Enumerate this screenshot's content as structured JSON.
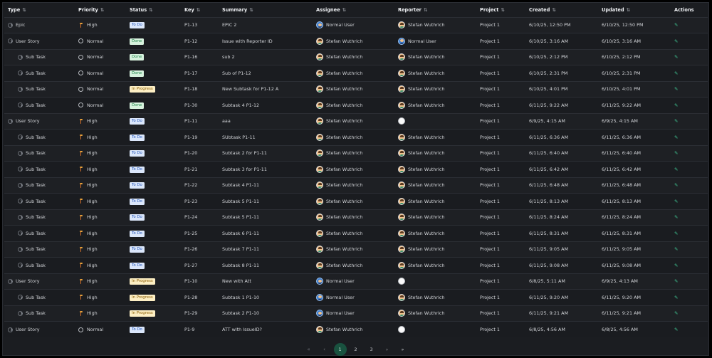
{
  "columns": {
    "type": "Type",
    "priority": "Priority",
    "status": "Status",
    "key": "Key",
    "summary": "Summary",
    "assignee": "Assignee",
    "reporter": "Reporter",
    "project": "Project",
    "created": "Created",
    "updated": "Updated",
    "actions": "Actions"
  },
  "sort_glyph": "⇅",
  "rows": [
    {
      "type": "Epic",
      "child": false,
      "priority": "High",
      "status": "To Do",
      "key": "P1-13",
      "summary": "EPIC 2",
      "assignee": "Normal User",
      "reporter": "Stefan Wuthrich",
      "project": "Project 1",
      "created": "6/10/25, 12:50 PM",
      "updated": "6/10/25, 12:50 PM"
    },
    {
      "type": "User Story",
      "child": false,
      "priority": "Normal",
      "status": "Done",
      "key": "P1-12",
      "summary": "Issue with Reporter ID",
      "assignee": "Stefan Wuthrich",
      "reporter": "Normal User",
      "project": "Project 1",
      "created": "6/10/25, 3:16 AM",
      "updated": "6/10/25, 3:16 AM"
    },
    {
      "type": "Sub Task",
      "child": true,
      "priority": "Normal",
      "status": "Done",
      "key": "P1-16",
      "summary": "sub 2",
      "assignee": "Stefan Wuthrich",
      "reporter": "Stefan Wuthrich",
      "project": "Project 1",
      "created": "6/10/25, 2:12 PM",
      "updated": "6/10/25, 2:12 PM"
    },
    {
      "type": "Sub Task",
      "child": true,
      "priority": "Normal",
      "status": "Done",
      "key": "P1-17",
      "summary": "Sub of P1-12",
      "assignee": "Stefan Wuthrich",
      "reporter": "Stefan Wuthrich",
      "project": "Project 1",
      "created": "6/10/25, 2:31 PM",
      "updated": "6/10/25, 2:31 PM"
    },
    {
      "type": "Sub Task",
      "child": true,
      "priority": "Normal",
      "status": "In Progress",
      "key": "P1-18",
      "summary": "New Subtask for P1-12 A",
      "assignee": "Stefan Wuthrich",
      "reporter": "Stefan Wuthrich",
      "project": "Project 1",
      "created": "6/10/25, 4:01 PM",
      "updated": "6/10/25, 4:01 PM"
    },
    {
      "type": "Sub Task",
      "child": true,
      "priority": "Normal",
      "status": "Done",
      "key": "P1-30",
      "summary": "Subtask 4 P1-12",
      "assignee": "Stefan Wuthrich",
      "reporter": "Stefan Wuthrich",
      "project": "Project 1",
      "created": "6/11/25, 9:22 AM",
      "updated": "6/11/25, 9:22 AM"
    },
    {
      "type": "User Story",
      "child": false,
      "priority": "High",
      "status": "To Do",
      "key": "P1-11",
      "summary": "aaa",
      "assignee": "Stefan Wuthrich",
      "reporter": "",
      "project": "Project 1",
      "created": "6/9/25, 4:15 AM",
      "updated": "6/9/25, 4:15 AM"
    },
    {
      "type": "Sub Task",
      "child": true,
      "priority": "High",
      "status": "To Do",
      "key": "P1-19",
      "summary": "SUbtask P1-11",
      "assignee": "Stefan Wuthrich",
      "reporter": "Stefan Wuthrich",
      "project": "Project 1",
      "created": "6/11/25, 6:36 AM",
      "updated": "6/11/25, 6:36 AM"
    },
    {
      "type": "Sub Task",
      "child": true,
      "priority": "High",
      "status": "To Do",
      "key": "P1-20",
      "summary": "Subtask 2 for P1-11",
      "assignee": "Stefan Wuthrich",
      "reporter": "Stefan Wuthrich",
      "project": "Project 1",
      "created": "6/11/25, 6:40 AM",
      "updated": "6/11/25, 6:40 AM"
    },
    {
      "type": "Sub Task",
      "child": true,
      "priority": "High",
      "status": "To Do",
      "key": "P1-21",
      "summary": "Subtask 3 for P1-11",
      "assignee": "Stefan Wuthrich",
      "reporter": "Stefan Wuthrich",
      "project": "Project 1",
      "created": "6/11/25, 6:42 AM",
      "updated": "6/11/25, 6:42 AM"
    },
    {
      "type": "Sub Task",
      "child": true,
      "priority": "High",
      "status": "To Do",
      "key": "P1-22",
      "summary": "Subtask 4 P1-11",
      "assignee": "Stefan Wuthrich",
      "reporter": "Stefan Wuthrich",
      "project": "Project 1",
      "created": "6/11/25, 6:48 AM",
      "updated": "6/11/25, 6:48 AM"
    },
    {
      "type": "Sub Task",
      "child": true,
      "priority": "High",
      "status": "To Do",
      "key": "P1-23",
      "summary": "Subtask 5 P1-11",
      "assignee": "Stefan Wuthrich",
      "reporter": "Stefan Wuthrich",
      "project": "Project 1",
      "created": "6/11/25, 8:13 AM",
      "updated": "6/11/25, 8:13 AM"
    },
    {
      "type": "Sub Task",
      "child": true,
      "priority": "High",
      "status": "To Do",
      "key": "P1-24",
      "summary": "Subtask 5 P1-11",
      "assignee": "Stefan Wuthrich",
      "reporter": "Stefan Wuthrich",
      "project": "Project 1",
      "created": "6/11/25, 8:24 AM",
      "updated": "6/11/25, 8:24 AM"
    },
    {
      "type": "Sub Task",
      "child": true,
      "priority": "High",
      "status": "To Do",
      "key": "P1-25",
      "summary": "Subtask 6 P1-11",
      "assignee": "Stefan Wuthrich",
      "reporter": "Stefan Wuthrich",
      "project": "Project 1",
      "created": "6/11/25, 8:31 AM",
      "updated": "6/11/25, 8:31 AM"
    },
    {
      "type": "Sub Task",
      "child": true,
      "priority": "High",
      "status": "To Do",
      "key": "P1-26",
      "summary": "Subtask 7 P1-11",
      "assignee": "Stefan Wuthrich",
      "reporter": "Stefan Wuthrich",
      "project": "Project 1",
      "created": "6/11/25, 9:05 AM",
      "updated": "6/11/25, 9:05 AM"
    },
    {
      "type": "Sub Task",
      "child": true,
      "priority": "High",
      "status": "To Do",
      "key": "P1-27",
      "summary": "Subtask 8 P1-11",
      "assignee": "Stefan Wuthrich",
      "reporter": "Stefan Wuthrich",
      "project": "Project 1",
      "created": "6/11/25, 9:08 AM",
      "updated": "6/11/25, 9:08 AM"
    },
    {
      "type": "User Story",
      "child": false,
      "priority": "High",
      "status": "In Progress",
      "key": "P1-10",
      "summary": "New with Att",
      "assignee": "Normal User",
      "reporter": "",
      "project": "Project 1",
      "created": "6/8/25, 5:11 AM",
      "updated": "6/9/25, 4:13 AM"
    },
    {
      "type": "Sub Task",
      "child": true,
      "priority": "High",
      "status": "In Progress",
      "key": "P1-28",
      "summary": "Subtask 1 P1-10",
      "assignee": "Normal User",
      "reporter": "Stefan Wuthrich",
      "project": "Project 1",
      "created": "6/11/25, 9:20 AM",
      "updated": "6/11/25, 9:20 AM"
    },
    {
      "type": "Sub Task",
      "child": true,
      "priority": "High",
      "status": "In Progress",
      "key": "P1-29",
      "summary": "Subtask 2 P1-10",
      "assignee": "Normal User",
      "reporter": "Stefan Wuthrich",
      "project": "Project 1",
      "created": "6/11/25, 9:21 AM",
      "updated": "6/11/25, 9:21 AM"
    },
    {
      "type": "User Story",
      "child": false,
      "priority": "Normal",
      "status": "To Do",
      "key": "P1-9",
      "summary": "ATT with IssueID?",
      "assignee": "Stefan Wuthrich",
      "reporter": "",
      "project": "Project 1",
      "created": "6/8/25, 4:56 AM",
      "updated": "6/8/25, 4:56 AM"
    }
  ],
  "pagination": {
    "first": "«",
    "prev": "‹",
    "pages": [
      "1",
      "2",
      "3"
    ],
    "active": "1",
    "next": "›",
    "last": "»"
  },
  "colors": {
    "background": "#1b1d21",
    "accent": "#3ec28f",
    "active_page": "#19523f"
  },
  "icons": {
    "edit": "✎",
    "sort": "sort-icon",
    "expand": "chevron-icon"
  }
}
